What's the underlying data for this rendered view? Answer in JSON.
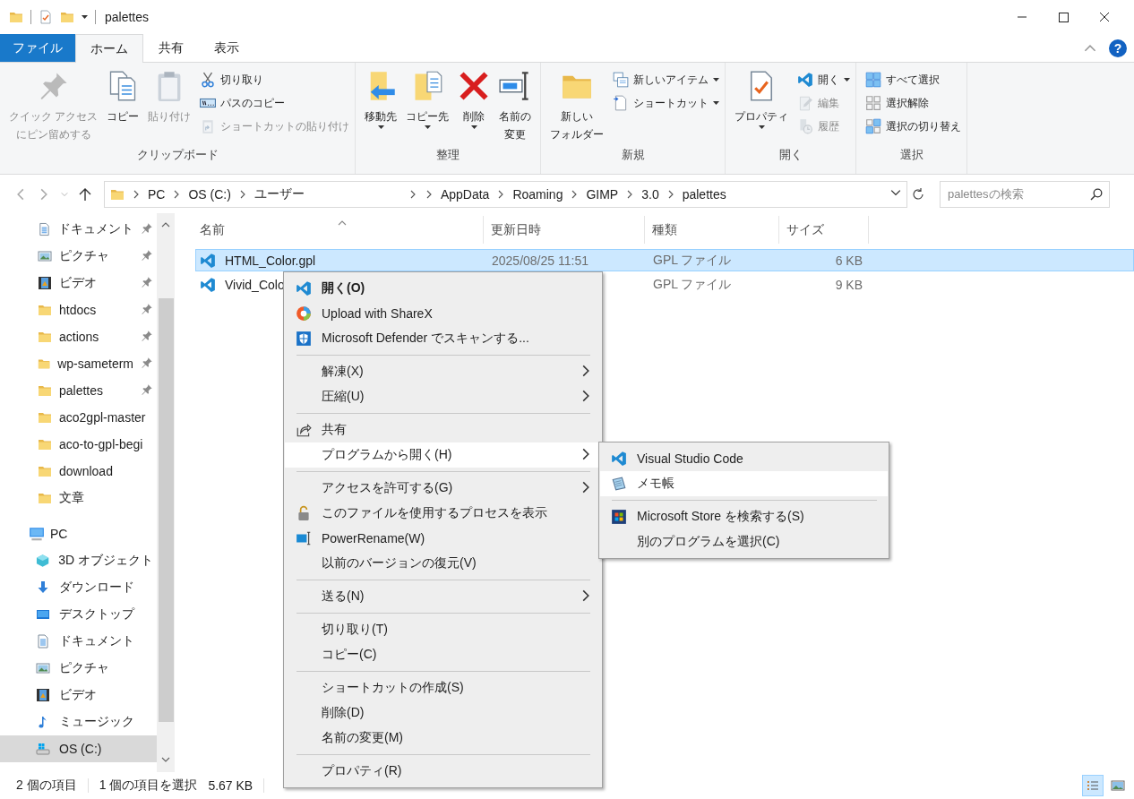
{
  "window": {
    "title": "palettes"
  },
  "ribbon_tabs": [
    {
      "label": "ファイル",
      "kind": "backstage",
      "selected": false
    },
    {
      "label": "ホーム",
      "kind": "tab",
      "selected": true
    },
    {
      "label": "共有",
      "kind": "tab",
      "selected": false
    },
    {
      "label": "表示",
      "kind": "tab",
      "selected": false
    }
  ],
  "help_button": "?",
  "ribbon_groups": [
    {
      "title": "クリップボード",
      "large": [
        {
          "lines": [
            "クイック アクセス",
            "にピン留めする"
          ],
          "disabled": true,
          "dropdown": false
        },
        {
          "lines": [
            "コピー"
          ],
          "disabled": false,
          "dropdown": false
        },
        {
          "lines": [
            "貼り付け"
          ],
          "disabled": true,
          "dropdown": false
        }
      ],
      "small": [
        {
          "label": "切り取り",
          "disabled": false,
          "dropdown": false
        },
        {
          "label": "パスのコピー",
          "disabled": false,
          "dropdown": false
        },
        {
          "label": "ショートカットの貼り付け",
          "disabled": true,
          "dropdown": false
        }
      ]
    },
    {
      "title": "整理",
      "large": [
        {
          "lines": [
            "移動先"
          ],
          "disabled": false,
          "dropdown": true
        },
        {
          "lines": [
            "コピー先"
          ],
          "disabled": false,
          "dropdown": true
        },
        {
          "lines": [
            "削除"
          ],
          "disabled": false,
          "dropdown": true
        },
        {
          "lines": [
            "名前の",
            "変更"
          ],
          "disabled": false,
          "dropdown": false
        }
      ]
    },
    {
      "title": "新規",
      "large": [
        {
          "lines": [
            "新しい",
            "フォルダー"
          ],
          "disabled": false,
          "dropdown": false
        }
      ],
      "small": [
        {
          "label": "新しいアイテム",
          "disabled": false,
          "dropdown": true
        },
        {
          "label": "ショートカット",
          "disabled": false,
          "dropdown": true
        }
      ]
    },
    {
      "title": "開く",
      "large": [
        {
          "lines": [
            "プロパティ"
          ],
          "disabled": false,
          "dropdown": true
        }
      ],
      "small": [
        {
          "label": "開く",
          "disabled": false,
          "dropdown": true
        },
        {
          "label": "編集",
          "disabled": true,
          "dropdown": false
        },
        {
          "label": "履歴",
          "disabled": true,
          "dropdown": false
        }
      ]
    },
    {
      "title": "選択",
      "small": [
        {
          "label": "すべて選択",
          "disabled": false,
          "dropdown": false
        },
        {
          "label": "選択解除",
          "disabled": false,
          "dropdown": false
        },
        {
          "label": "選択の切り替え",
          "disabled": false,
          "dropdown": false
        }
      ]
    }
  ],
  "address_bar": {
    "crumbs": [
      {
        "label": "PC",
        "gap_before": false
      },
      {
        "label": "OS (C:)",
        "gap_before": false
      },
      {
        "label": "ユーザー",
        "gap_before": false
      },
      {
        "label": "AppData",
        "gap_before": true
      },
      {
        "label": "Roaming",
        "gap_before": false
      },
      {
        "label": "GIMP",
        "gap_before": false
      },
      {
        "label": "3.0",
        "gap_before": false
      },
      {
        "label": "palettes",
        "gap_before": false
      }
    ]
  },
  "search": {
    "placeholder": "palettesの検索"
  },
  "navigation": {
    "quick_access": [
      {
        "label": "ドキュメント",
        "pinned": true,
        "selected": false
      },
      {
        "label": "ピクチャ",
        "pinned": true,
        "selected": false
      },
      {
        "label": "ビデオ",
        "pinned": true,
        "selected": false
      },
      {
        "label": "htdocs",
        "pinned": true,
        "selected": false
      },
      {
        "label": "actions",
        "pinned": true,
        "selected": false
      },
      {
        "label": "wp-sameterm",
        "pinned": true,
        "selected": false
      },
      {
        "label": "palettes",
        "pinned": true,
        "selected": false
      },
      {
        "label": "aco2gpl-master",
        "pinned": false,
        "selected": false
      },
      {
        "label": "aco-to-gpl-begi",
        "pinned": false,
        "selected": false
      },
      {
        "label": "download",
        "pinned": false,
        "selected": false
      },
      {
        "label": "文章",
        "pinned": false,
        "selected": false
      }
    ],
    "pc": {
      "label": "PC",
      "selected": false,
      "children": [
        {
          "label": "3D オブジェクト",
          "selected": false
        },
        {
          "label": "ダウンロード",
          "selected": false
        },
        {
          "label": "デスクトップ",
          "selected": false
        },
        {
          "label": "ドキュメント",
          "selected": false
        },
        {
          "label": "ピクチャ",
          "selected": false
        },
        {
          "label": "ビデオ",
          "selected": false
        },
        {
          "label": "ミュージック",
          "selected": false
        },
        {
          "label": "OS (C:)",
          "selected": true
        }
      ]
    }
  },
  "file_list": {
    "columns": [
      {
        "label": "名前",
        "sorted": true
      },
      {
        "label": "更新日時",
        "sorted": false
      },
      {
        "label": "種類",
        "sorted": false
      },
      {
        "label": "サイズ",
        "sorted": false
      }
    ],
    "rows": [
      {
        "name": "HTML_Color.gpl",
        "modified": "2025/08/25 11:51",
        "type": "GPL ファイル",
        "size": "6 KB",
        "selected": true
      },
      {
        "name": "Vivid_Colo",
        "type": "GPL ファイル",
        "size": "9 KB",
        "selected": false
      }
    ]
  },
  "context_menu": {
    "items": [
      {
        "kind": "item",
        "label": "開く(O)",
        "bold": true,
        "submenu": false,
        "selected": false
      },
      {
        "kind": "item",
        "label": "Upload with ShareX",
        "bold": false,
        "submenu": false,
        "selected": false
      },
      {
        "kind": "item",
        "label": "Microsoft Defender でスキャンする...",
        "bold": false,
        "submenu": false,
        "selected": false
      },
      {
        "kind": "separator"
      },
      {
        "kind": "item",
        "label": "解凍(X)",
        "bold": false,
        "submenu": true,
        "selected": false
      },
      {
        "kind": "item",
        "label": "圧縮(U)",
        "bold": false,
        "submenu": true,
        "selected": false
      },
      {
        "kind": "separator"
      },
      {
        "kind": "item",
        "label": "共有",
        "bold": false,
        "submenu": false,
        "selected": false
      },
      {
        "kind": "item",
        "label": "プログラムから開く(H)",
        "bold": false,
        "submenu": true,
        "selected": true
      },
      {
        "kind": "separator"
      },
      {
        "kind": "item",
        "label": "アクセスを許可する(G)",
        "bold": false,
        "submenu": true,
        "selected": false
      },
      {
        "kind": "item",
        "label": "このファイルを使用するプロセスを表示",
        "bold": false,
        "submenu": false,
        "selected": false
      },
      {
        "kind": "item",
        "label": "PowerRename(W)",
        "bold": false,
        "submenu": false,
        "selected": false
      },
      {
        "kind": "item",
        "label": "以前のバージョンの復元(V)",
        "bold": false,
        "submenu": false,
        "selected": false
      },
      {
        "kind": "separator"
      },
      {
        "kind": "item",
        "label": "送る(N)",
        "bold": false,
        "submenu": true,
        "selected": false
      },
      {
        "kind": "separator"
      },
      {
        "kind": "item",
        "label": "切り取り(T)",
        "bold": false,
        "submenu": false,
        "selected": false
      },
      {
        "kind": "item",
        "label": "コピー(C)",
        "bold": false,
        "submenu": false,
        "selected": false
      },
      {
        "kind": "separator"
      },
      {
        "kind": "item",
        "label": "ショートカットの作成(S)",
        "bold": false,
        "submenu": false,
        "selected": false
      },
      {
        "kind": "item",
        "label": "削除(D)",
        "bold": false,
        "submenu": false,
        "selected": false
      },
      {
        "kind": "item",
        "label": "名前の変更(M)",
        "bold": false,
        "submenu": false,
        "selected": false
      },
      {
        "kind": "separator"
      },
      {
        "kind": "item",
        "label": "プロパティ(R)",
        "bold": false,
        "submenu": false,
        "selected": false
      }
    ]
  },
  "submenu": {
    "items": [
      {
        "kind": "item",
        "label": "Visual Studio Code",
        "bold": false,
        "submenu": false,
        "selected": false
      },
      {
        "kind": "item",
        "label": "メモ帳",
        "bold": false,
        "submenu": false,
        "selected": true
      },
      {
        "kind": "separator"
      },
      {
        "kind": "item",
        "label": "Microsoft Store を検索する(S)",
        "bold": false,
        "submenu": false,
        "selected": false
      },
      {
        "kind": "item",
        "label": "別のプログラムを選択(C)",
        "bold": false,
        "submenu": false,
        "selected": false
      }
    ]
  },
  "status_bar": {
    "item_count": "2 個の項目",
    "selection": "1 個の項目を選択",
    "selection_size": "5.67 KB",
    "views": [
      {
        "kind": "details",
        "selected": true
      },
      {
        "kind": "large_icons",
        "selected": false
      }
    ]
  }
}
